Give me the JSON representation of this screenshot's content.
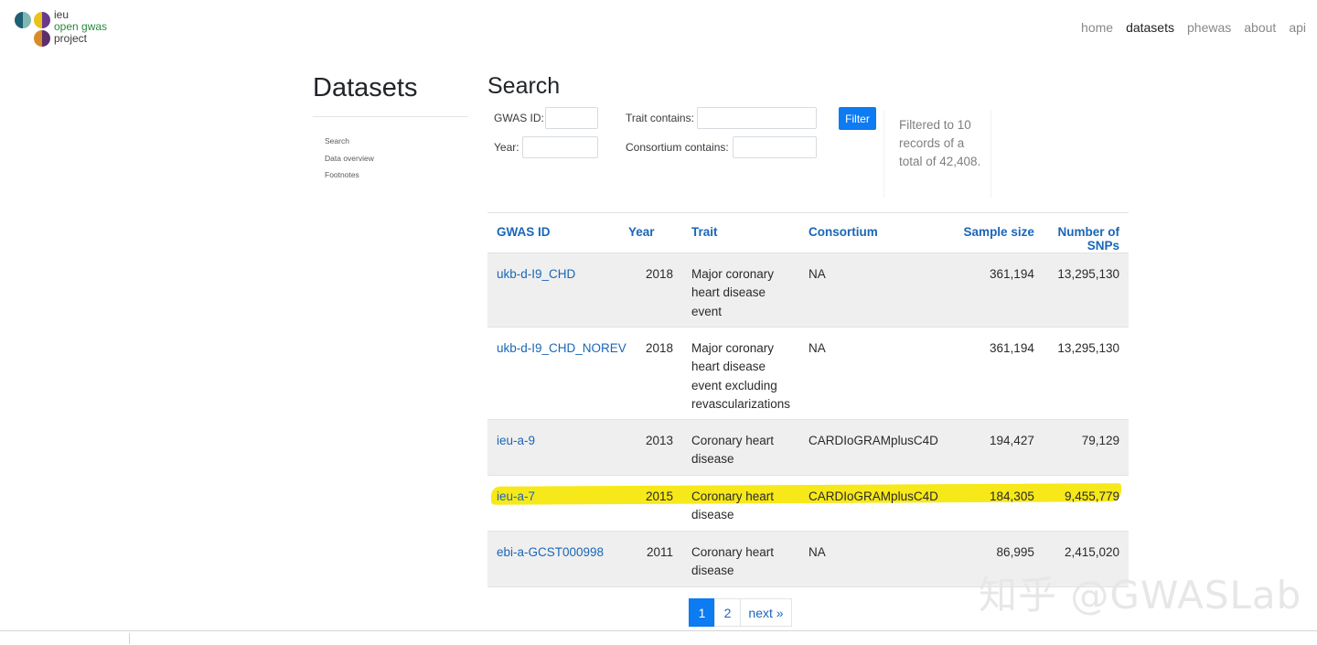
{
  "logo": {
    "line1": "ieu",
    "line2": "open gwas",
    "line3": "project"
  },
  "nav": {
    "home": "home",
    "datasets": "datasets",
    "phewas": "phewas",
    "about": "about",
    "api": "api"
  },
  "sidebar": {
    "title": "Datasets",
    "links": [
      "Search",
      "Data overview",
      "Footnotes"
    ]
  },
  "search": {
    "title": "Search",
    "gwas_id_label": "GWAS ID:",
    "year_label": "Year:",
    "trait_label": "Trait contains:",
    "consortium_label": "Consortium contains:",
    "gwas_id_value": "",
    "year_value": "",
    "trait_value": "",
    "consortium_value": "",
    "filter_label": "Filter",
    "filtered_text": "Filtered to 10 records of a total of 42,408."
  },
  "table": {
    "headers": [
      "GWAS ID",
      "Year",
      "Trait",
      "Consortium",
      "Sample size",
      "Number of SNPs"
    ],
    "rows": [
      {
        "id": "ukb-d-I9_CHD",
        "year": "2018",
        "trait": "Major coronary heart disease event",
        "consortium": "NA",
        "sample_size": "361,194",
        "snps": "13,295,130"
      },
      {
        "id": "ukb-d-I9_CHD_NOREV",
        "year": "2018",
        "trait": "Major coronary heart disease event excluding revascularizations",
        "consortium": "NA",
        "sample_size": "361,194",
        "snps": "13,295,130"
      },
      {
        "id": "ieu-a-9",
        "year": "2013",
        "trait": "Coronary heart disease",
        "consortium": "CARDIoGRAMplusC4D",
        "sample_size": "194,427",
        "snps": "79,129"
      },
      {
        "id": "ieu-a-7",
        "year": "2015",
        "trait": "Coronary heart disease",
        "consortium": "CARDIoGRAMplusC4D",
        "sample_size": "184,305",
        "snps": "9,455,779"
      },
      {
        "id": "ebi-a-GCST000998",
        "year": "2011",
        "trait": "Coronary heart disease",
        "consortium": "NA",
        "sample_size": "86,995",
        "snps": "2,415,020"
      }
    ]
  },
  "pagination": {
    "pages": [
      "1",
      "2"
    ],
    "next": "next »",
    "active": "1"
  },
  "watermark": "知乎 @GWASLab",
  "colors": {
    "link": "#1a66b7",
    "primary": "#0d7bf2",
    "highlight": "#f7e81a"
  }
}
